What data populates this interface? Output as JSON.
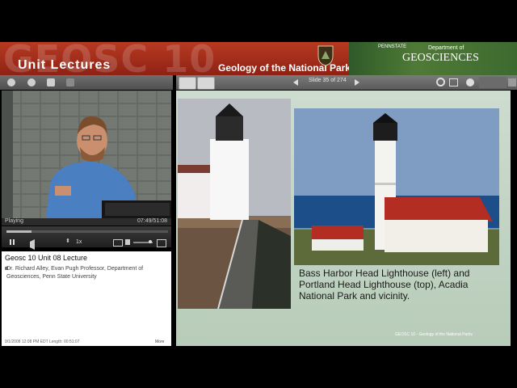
{
  "banner": {
    "big_word": "GEOSC 10",
    "unit_lectures": "Unit Lectures",
    "course_title": "Geology of the National Parks",
    "psu": "PENNSTATE",
    "dept_small": "Department of",
    "dept_big": "GEOSCIENCES"
  },
  "toolbar": {
    "slide_indicator": "Slide 35 of 274"
  },
  "player": {
    "status": "Playing",
    "time": "07:49/51:08",
    "speed": "1x",
    "progress_fraction": 0.153
  },
  "info": {
    "title": "Geosc 10 Unit 08 Lecture",
    "presenter": "Dr. Richard Alley, Evan Pugh Professor, Department of Geosciences, Penn State University",
    "footer": "9/1/2008   12:08 PM EDT   Length: 00:51:07",
    "more": "More"
  },
  "slide": {
    "caption": "Bass Harbor Head Lighthouse (left) and Portland Head Lighthouse (top), Acadia National Park and vicinity.",
    "footer": "GEOSC 10 - Geology of the National Parks"
  }
}
